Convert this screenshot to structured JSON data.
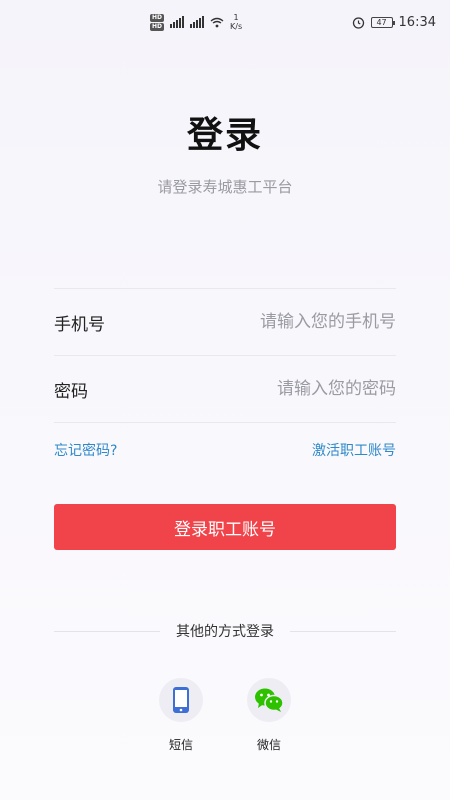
{
  "status_bar": {
    "net_rate_value": "1",
    "net_rate_unit": "K/s",
    "battery": "47",
    "time": "16:34"
  },
  "page": {
    "title": "登录",
    "subtitle": "请登录寿城惠工平台"
  },
  "form": {
    "phone_label": "手机号",
    "phone_placeholder": "请输入您的手机号",
    "password_label": "密码",
    "password_placeholder": "请输入您的密码",
    "forgot_label": "忘记密码?",
    "activate_label": "激活职工账号",
    "submit_label": "登录职工账号"
  },
  "other_login": {
    "heading": "其他的方式登录",
    "options": [
      {
        "label": "短信",
        "icon": "phone-icon"
      },
      {
        "label": "微信",
        "icon": "wechat-icon"
      }
    ]
  },
  "colors": {
    "accent": "#f0444a",
    "link": "#2f89c9",
    "wechat": "#2dc100",
    "sms": "#3d6fd6"
  }
}
